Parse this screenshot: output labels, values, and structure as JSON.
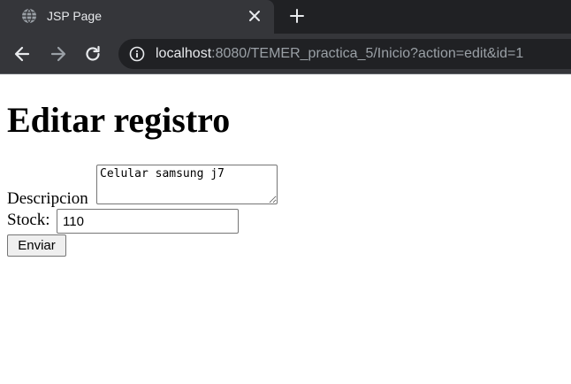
{
  "browser": {
    "tab_title": "JSP Page",
    "url_host": "localhost",
    "url_rest": ":8080/TEMER_practica_5/Inicio?action=edit&id=1"
  },
  "page": {
    "title": "Editar registro",
    "description_label": "Descripcion",
    "description_value": "Celular samsung j7",
    "stock_label": "Stock:",
    "stock_value": "110",
    "submit_label": "Enviar"
  },
  "icons": {
    "favicon": "globe-icon",
    "tab_close": "close-icon",
    "new_tab": "plus-icon",
    "back": "arrow-left-icon",
    "forward": "arrow-right-icon",
    "reload": "reload-icon",
    "site_info": "info-icon"
  },
  "colors": {
    "tabstrip_bg": "#202124",
    "toolbar_bg": "#35363a",
    "omnibox_bg": "#202124",
    "button_bg": "#efefef"
  }
}
